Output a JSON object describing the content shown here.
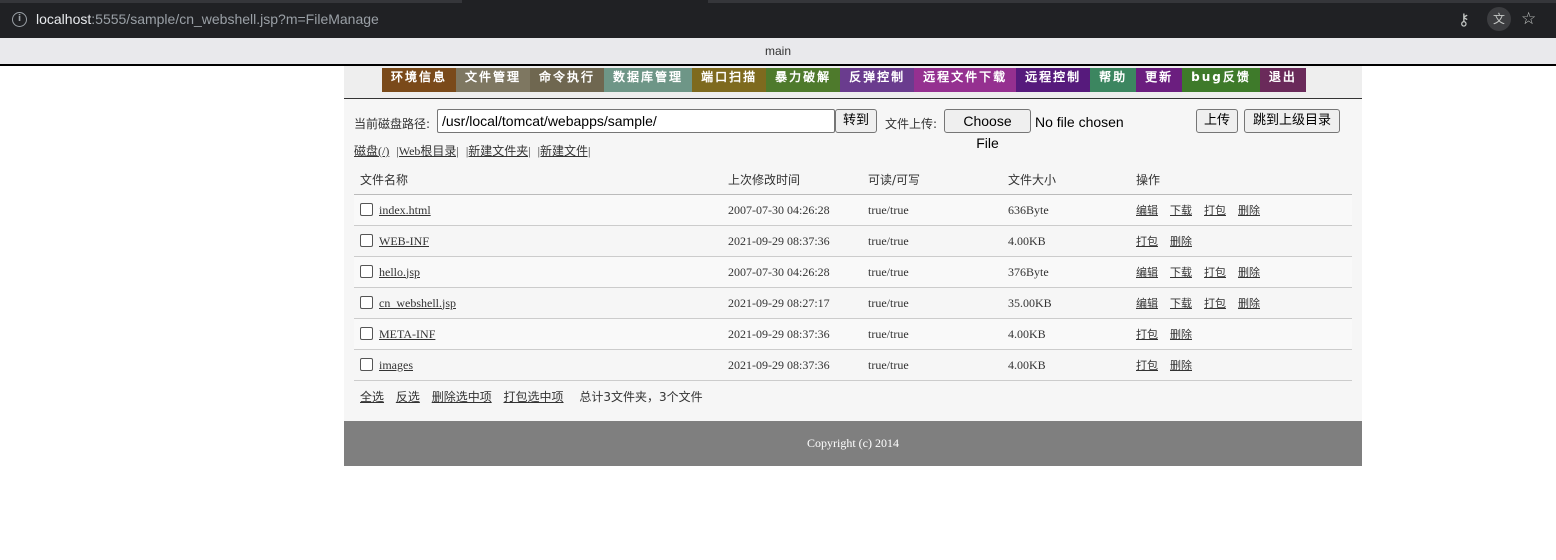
{
  "browser": {
    "url_host": "localhost",
    "url_rest": ":5555/sample/cn_webshell.jsp?m=FileManage",
    "icons": [
      "info-icon",
      "key-icon",
      "translate-icon",
      "star-icon"
    ]
  },
  "frame": {
    "title": "main"
  },
  "nav": {
    "items": [
      {
        "label": "环境信息",
        "color": "#7a4a1a"
      },
      {
        "label": "文件管理",
        "color": "#7e7761"
      },
      {
        "label": "命令执行",
        "color": "#6f6750"
      },
      {
        "label": "数据库管理",
        "color": "#6e9687"
      },
      {
        "label": "端口扫描",
        "color": "#7e6a1e"
      },
      {
        "label": "暴力破解",
        "color": "#4e7a2c"
      },
      {
        "label": "反弹控制",
        "color": "#6a3c8e"
      },
      {
        "label": "远程文件下载",
        "color": "#953090"
      },
      {
        "label": "远程控制",
        "color": "#561a7c"
      },
      {
        "label": "帮助",
        "color": "#3c8660"
      },
      {
        "label": "更新",
        "color": "#6b1e7f"
      },
      {
        "label": "bug反馈",
        "color": "#3e7a2a"
      },
      {
        "label": "退出",
        "color": "#6a2a5a"
      }
    ]
  },
  "pathbar": {
    "label": "当前磁盘路径:",
    "path_value": "/usr/local/tomcat/webapps/sample/",
    "go_button": "转到",
    "upload_label": "文件上传:",
    "choose_file_button": "Choose File",
    "no_file_text": "No file chosen",
    "upload_button": "上传",
    "parent_dir_button": "跳到上级目录"
  },
  "quicklinks": [
    "磁盘(/)",
    "|Web根目录|",
    "|新建文件夹|",
    "|新建文件|"
  ],
  "table": {
    "headers": [
      "文件名称",
      "上次修改时间",
      "可读/可写",
      "文件大小",
      "操作"
    ],
    "rows": [
      {
        "name": "index.html",
        "modified": "2007-07-30 04:26:28",
        "rw": "true/true",
        "size": "636Byte",
        "ops": [
          "编辑",
          "下载",
          "打包",
          "删除"
        ]
      },
      {
        "name": "WEB-INF",
        "modified": "2021-09-29 08:37:36",
        "rw": "true/true",
        "size": "4.00KB",
        "ops": [
          "打包",
          "删除"
        ]
      },
      {
        "name": "hello.jsp",
        "modified": "2007-07-30 04:26:28",
        "rw": "true/true",
        "size": "376Byte",
        "ops": [
          "编辑",
          "下载",
          "打包",
          "删除"
        ]
      },
      {
        "name": "cn_webshell.jsp",
        "modified": "2021-09-29 08:27:17",
        "rw": "true/true",
        "size": "35.00KB",
        "ops": [
          "编辑",
          "下载",
          "打包",
          "删除"
        ]
      },
      {
        "name": "META-INF",
        "modified": "2021-09-29 08:37:36",
        "rw": "true/true",
        "size": "4.00KB",
        "ops": [
          "打包",
          "删除"
        ]
      },
      {
        "name": "images",
        "modified": "2021-09-29 08:37:36",
        "rw": "true/true",
        "size": "4.00KB",
        "ops": [
          "打包",
          "删除"
        ]
      }
    ]
  },
  "footer_actions": {
    "links": [
      "全选",
      "反选",
      "删除选中项",
      "打包选中项"
    ],
    "summary": "总计3文件夹，3个文件"
  },
  "copyright": "Copyright (c) 2014"
}
